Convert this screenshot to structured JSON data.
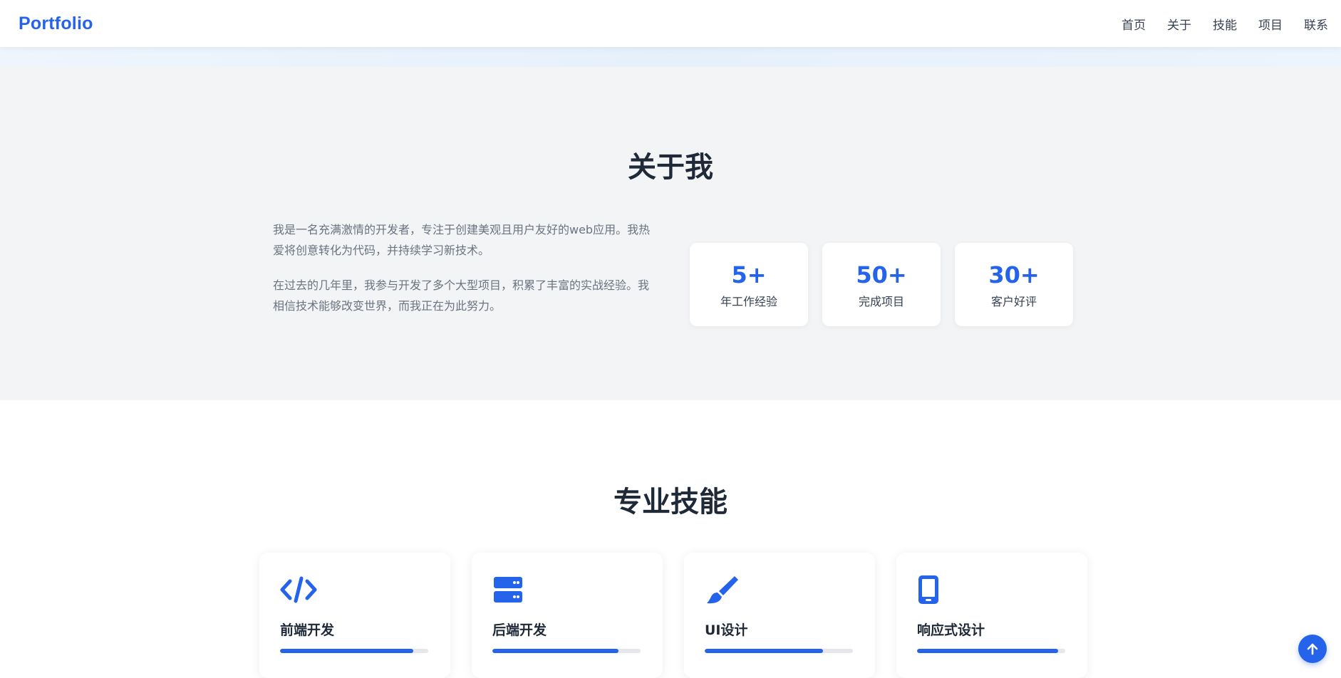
{
  "header": {
    "logo": "Portfolio",
    "nav": [
      "首页",
      "关于",
      "技能",
      "项目",
      "联系"
    ]
  },
  "about": {
    "title": "关于我",
    "paragraphs": [
      "我是一名充满激情的开发者，专注于创建美观且用户友好的web应用。我热爱将创意转化为代码，并持续学习新技术。",
      "在过去的几年里，我参与开发了多个大型项目，积累了丰富的实战经验。我相信技术能够改变世界，而我正在为此努力。"
    ],
    "stats": [
      {
        "value": "5+",
        "label": "年工作经验"
      },
      {
        "value": "50+",
        "label": "完成项目"
      },
      {
        "value": "30+",
        "label": "客户好评"
      }
    ]
  },
  "skills": {
    "title": "专业技能",
    "items": [
      {
        "name": "前端开发",
        "icon": "code-icon",
        "level": 0.9
      },
      {
        "name": "后端开发",
        "icon": "server-icon",
        "level": 0.85
      },
      {
        "name": "UI设计",
        "icon": "brush-icon",
        "level": 0.8
      },
      {
        "name": "响应式设计",
        "icon": "mobile-icon",
        "level": 0.95
      }
    ]
  },
  "colors": {
    "accent": "#2563eb",
    "about_bg": "#f3f4f6"
  },
  "back_to_top_icon": "arrow-up-icon"
}
